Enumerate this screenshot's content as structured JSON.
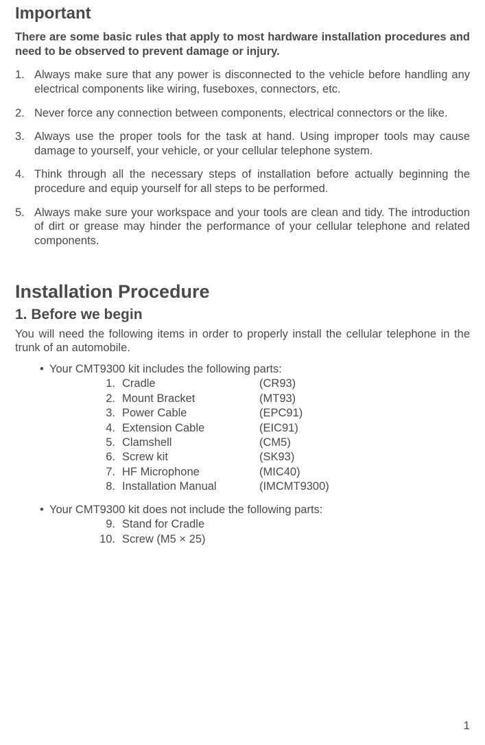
{
  "important": {
    "heading": "Important",
    "lead": "There are some basic rules that apply to most hardware installation procedures and need to be observed to prevent damage or injury.",
    "rules": [
      "Always make sure that any power is disconnected to the vehicle before handling any electrical components like wiring, fuseboxes, connectors, etc.",
      "Never force any connection between components, electrical connectors or the like.",
      "Always use the proper tools for the task at hand.  Using improper tools may cause damage to yourself, your vehicle, or your cellular telephone system.",
      "Think through all the necessary steps of installation before actually beginning the procedure and equip yourself for all steps to be performed.",
      "Always make sure your workspace and your tools are clean and tidy.  The introduction of dirt or grease may hinder the performance of your cellular telephone and related components."
    ]
  },
  "installation": {
    "heading": "Installation Procedure",
    "subheading": "1.  Before we begin",
    "intro": "You will need the following items in order to properly install the cellular telephone in the trunk of an automobile.",
    "includes_label": "Your CMT9300 kit includes the following parts:",
    "included_parts": [
      {
        "n": "1.",
        "name": "Cradle",
        "code": "(CR93)"
      },
      {
        "n": "2.",
        "name": "Mount Bracket",
        "code": "(MT93)"
      },
      {
        "n": "3.",
        "name": "Power Cable",
        "code": "(EPC91)"
      },
      {
        "n": "4.",
        "name": "Extension Cable",
        "code": "(EIC91)"
      },
      {
        "n": "5.",
        "name": "Clamshell",
        "code": "(CM5)"
      },
      {
        "n": "6.",
        "name": "Screw kit",
        "code": "(SK93)"
      },
      {
        "n": "7.",
        "name": "HF Microphone",
        "code": "(MIC40)"
      },
      {
        "n": "8.",
        "name": "Installation Manual",
        "code": "(IMCMT9300)"
      }
    ],
    "excludes_label": "Your CMT9300 kit does not include the following parts:",
    "excluded_parts": [
      {
        "n": "9.",
        "name": "Stand for Cradle",
        "code": ""
      },
      {
        "n": "10.",
        "name": "Screw (M5 × 25)",
        "code": ""
      }
    ]
  },
  "page_number": "1"
}
